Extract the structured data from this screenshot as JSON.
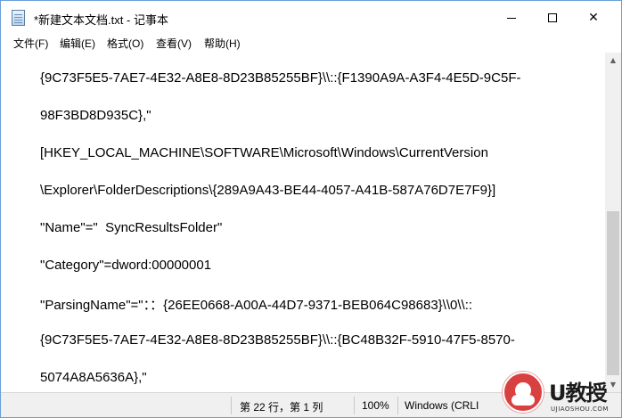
{
  "window": {
    "title": "*新建文本文档.txt - 记事本",
    "icon": "notepad-icon",
    "controls": {
      "minimize": "minimize-icon",
      "maximize": "maximize-icon",
      "close_glyph": "✕"
    }
  },
  "menu": [
    {
      "label": "文件",
      "key": "F",
      "text": "文件(F)"
    },
    {
      "label": "编辑",
      "key": "E",
      "text": "编辑(E)"
    },
    {
      "label": "格式",
      "key": "O",
      "text": "格式(O)"
    },
    {
      "label": "查看",
      "key": "V",
      "text": "查看(V)"
    },
    {
      "label": "帮助",
      "key": "H",
      "text": "帮助(H)"
    }
  ],
  "editor": {
    "lines": [
      "{9C73F5E5-7AE7-4E32-A8E8-8D23B85255BF}\\\\::{F1390A9A-A3F4-4E5D-9C5F-",
      "98F3BD8D935C},\"",
      "[HKEY_LOCAL_MACHINE\\SOFTWARE\\Microsoft\\Windows\\CurrentVersion",
      "\\Explorer\\FolderDescriptions\\{289A9A43-BE44-4057-A41B-587A76D7E7F9}]",
      "\"Name\"=\"  SyncResultsFolder\"",
      "\"Category\"=dword:00000001",
      "\"ParsingName\"=\"：：{26EE0668-A00A-44D7-9371-BEB064C98683}\\\\0\\\\::",
      "{9C73F5E5-7AE7-4E32-A8E8-8D23B85255BF}\\\\::{BC48B32F-5910-47F5-8570-",
      "5074A8A5636A},\""
    ]
  },
  "statusbar": {
    "position": "第 22 行，第 1 列",
    "zoom": "100%",
    "line_ending": "Windows (CRLI"
  },
  "watermark": {
    "brand": "U教授",
    "site": "UJIAOSHOU.COM",
    "accent": "#d94141"
  },
  "colors": {
    "window_border": "#6b9ed6",
    "statusbar_bg": "#f0f0f0",
    "scroll_thumb": "#cdcdcd"
  }
}
